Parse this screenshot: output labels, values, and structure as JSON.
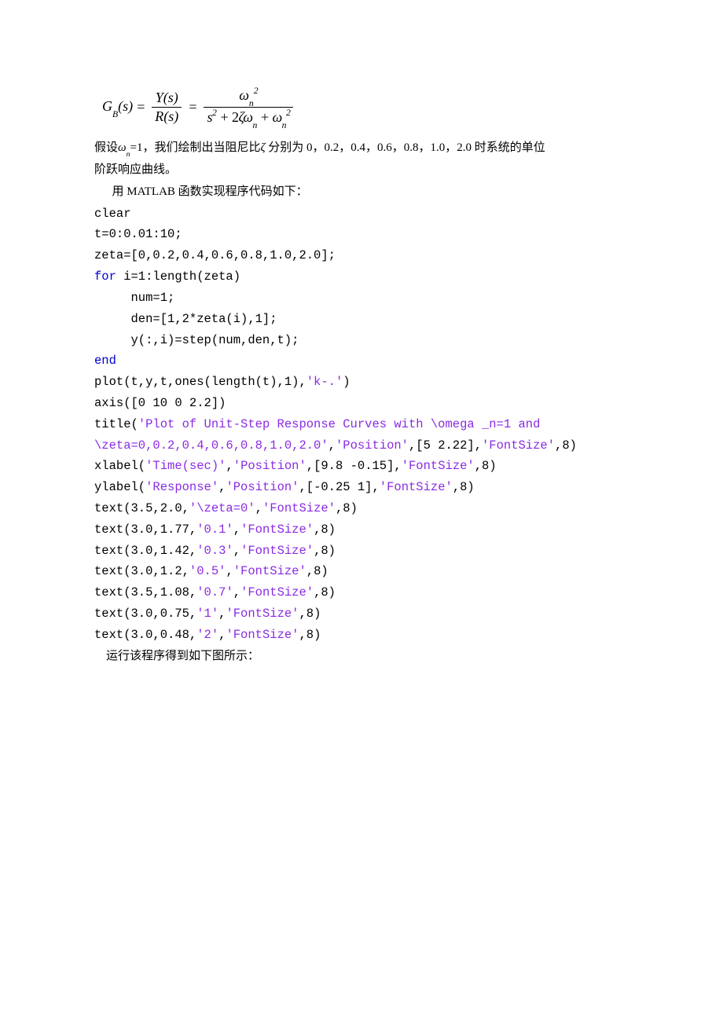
{
  "formula": {
    "left_G": "G",
    "left_B": "B",
    "left_args": "(s)",
    "equals": "=",
    "frac1_num_Y": "Y",
    "frac1_num_args": "(s)",
    "frac1_den_R": "R",
    "frac1_den_args": "(s)",
    "frac2_num_base": "ω",
    "frac2_num_sub": "n",
    "frac2_num_sup": "2",
    "frac2_den_s": "s",
    "frac2_den_s_sup": "2",
    "frac2_den_plus1": "+",
    "frac2_den_2": "2",
    "frac2_den_zeta": "ζ",
    "frac2_den_omega1": "ω",
    "frac2_den_omega1_sub": "n",
    "frac2_den_plus2": "+",
    "frac2_den_omega2": "ω",
    "frac2_den_omega2_sub": "n",
    "frac2_den_omega2_sup": "2"
  },
  "body": {
    "line1_a": "假设",
    "line1_omega": "ω",
    "line1_sub": "n",
    "line1_b": "=1，我们绘制出当阻尼比",
    "line1_zeta": "ζ",
    "line1_c": " 分别为 0，0.2，0.4，0.6，0.8，1.0，2.0 时系统的单位",
    "line2": "阶跃响应曲线。",
    "line3": "用 MATLAB 函数实现程序代码如下："
  },
  "code": {
    "l01": "clear",
    "l02": "t=0:0.01:10;",
    "l03": "zeta=[0,0.2,0.4,0.6,0.8,1.0,2.0];",
    "l04_kw": "for",
    "l04_rest": " i=1:length(zeta)",
    "l05": "     num=1;",
    "l06": "     den=[1,2*zeta(i),1];",
    "l07": "     y(:,i)=step(num,den,t);",
    "l08_kw": "end",
    "l09_a": "plot(t,y,t,ones(length(t),1),",
    "l09_s": "'k-.'",
    "l09_c": ")",
    "l10": "axis([0 10 0 2.2])",
    "l11_a": "title(",
    "l11_s1": "'Plot of Unit-Step Response Curves with \\omega _n=1 and ",
    "l12_s": "\\zeta=0,0.2,0.4,0.6,0.8,1.0,2.0'",
    "l12_b": ",",
    "l12_s2": "'Position'",
    "l12_c": ",[5 2.22],",
    "l12_s3": "'FontSize'",
    "l12_d": ",8)",
    "l13_a": "xlabel(",
    "l13_s1": "'Time(sec)'",
    "l13_b": ",",
    "l13_s2": "'Position'",
    "l13_c": ",[9.8 -0.15],",
    "l13_s3": "'FontSize'",
    "l13_d": ",8)",
    "l14_a": "ylabel(",
    "l14_s1": "'Response'",
    "l14_b": ",",
    "l14_s2": "'Position'",
    "l14_c": ",[-0.25 1],",
    "l14_s3": "'FontSize'",
    "l14_d": ",8)",
    "l15_a": "text(3.5,2.0,",
    "l15_s1": "'\\zeta=0'",
    "l15_b": ",",
    "l15_s2": "'FontSize'",
    "l15_c": ",8)",
    "l16_a": "text(3.0,1.77,",
    "l16_s1": "'0.1'",
    "l16_b": ",",
    "l16_s2": "'FontSize'",
    "l16_c": ",8)",
    "l17_a": "text(3.0,1.42,",
    "l17_s1": "'0.3'",
    "l17_b": ",",
    "l17_s2": "'FontSize'",
    "l17_c": ",8)",
    "l18_a": "text(3.0,1.2,",
    "l18_s1": "'0.5'",
    "l18_b": ",",
    "l18_s2": "'FontSize'",
    "l18_c": ",8)",
    "l19_a": "text(3.5,1.08,",
    "l19_s1": "'0.7'",
    "l19_b": ",",
    "l19_s2": "'FontSize'",
    "l19_c": ",8)",
    "l20_a": "text(3.0,0.75,",
    "l20_s1": "'1'",
    "l20_b": ",",
    "l20_s2": "'FontSize'",
    "l20_c": ",8)",
    "l21_a": "text(3.0,0.48,",
    "l21_s1": "'2'",
    "l21_b": ",",
    "l21_s2": "'FontSize'",
    "l21_c": ",8)"
  },
  "footer": {
    "line": "运行该程序得到如下图所示："
  }
}
